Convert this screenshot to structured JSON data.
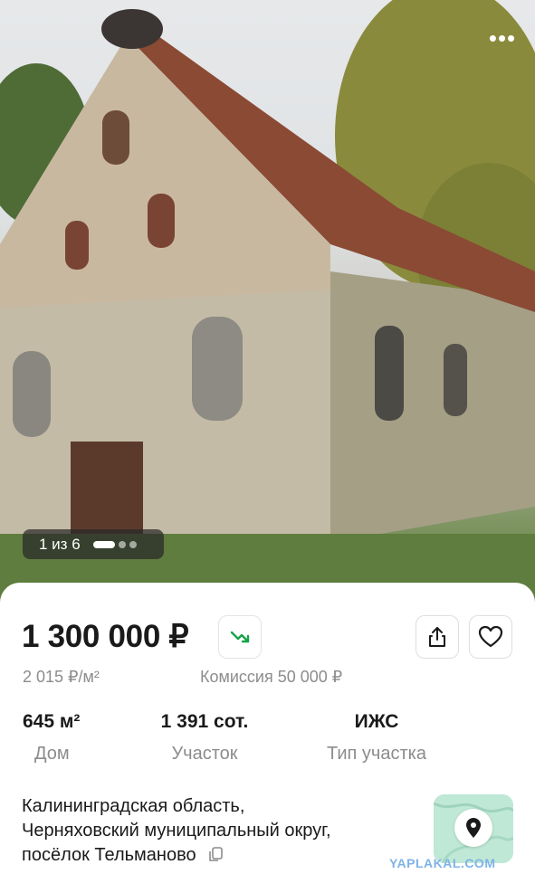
{
  "photo": {
    "counter": "1 из 6",
    "more_icon": "more-horizontal-icon"
  },
  "listing": {
    "price": "1 300 000 ₽",
    "price_per_m2": "2 015 ₽/м²",
    "commission": "Комиссия 50 000 ₽",
    "trend_icon": "price-down-trend-icon",
    "trend_color": "#17a34a",
    "stats": [
      {
        "value": "645 м²",
        "label": "Дом"
      },
      {
        "value": "1 391 сот.",
        "label": "Участок"
      },
      {
        "value": "ИЖС",
        "label": "Тип участка"
      }
    ],
    "address_lines": [
      "Калининградская область,",
      "Черняховский муниципальный округ,",
      "посёлок Тельманово"
    ]
  },
  "watermark": "YAPLAKAL.COM"
}
